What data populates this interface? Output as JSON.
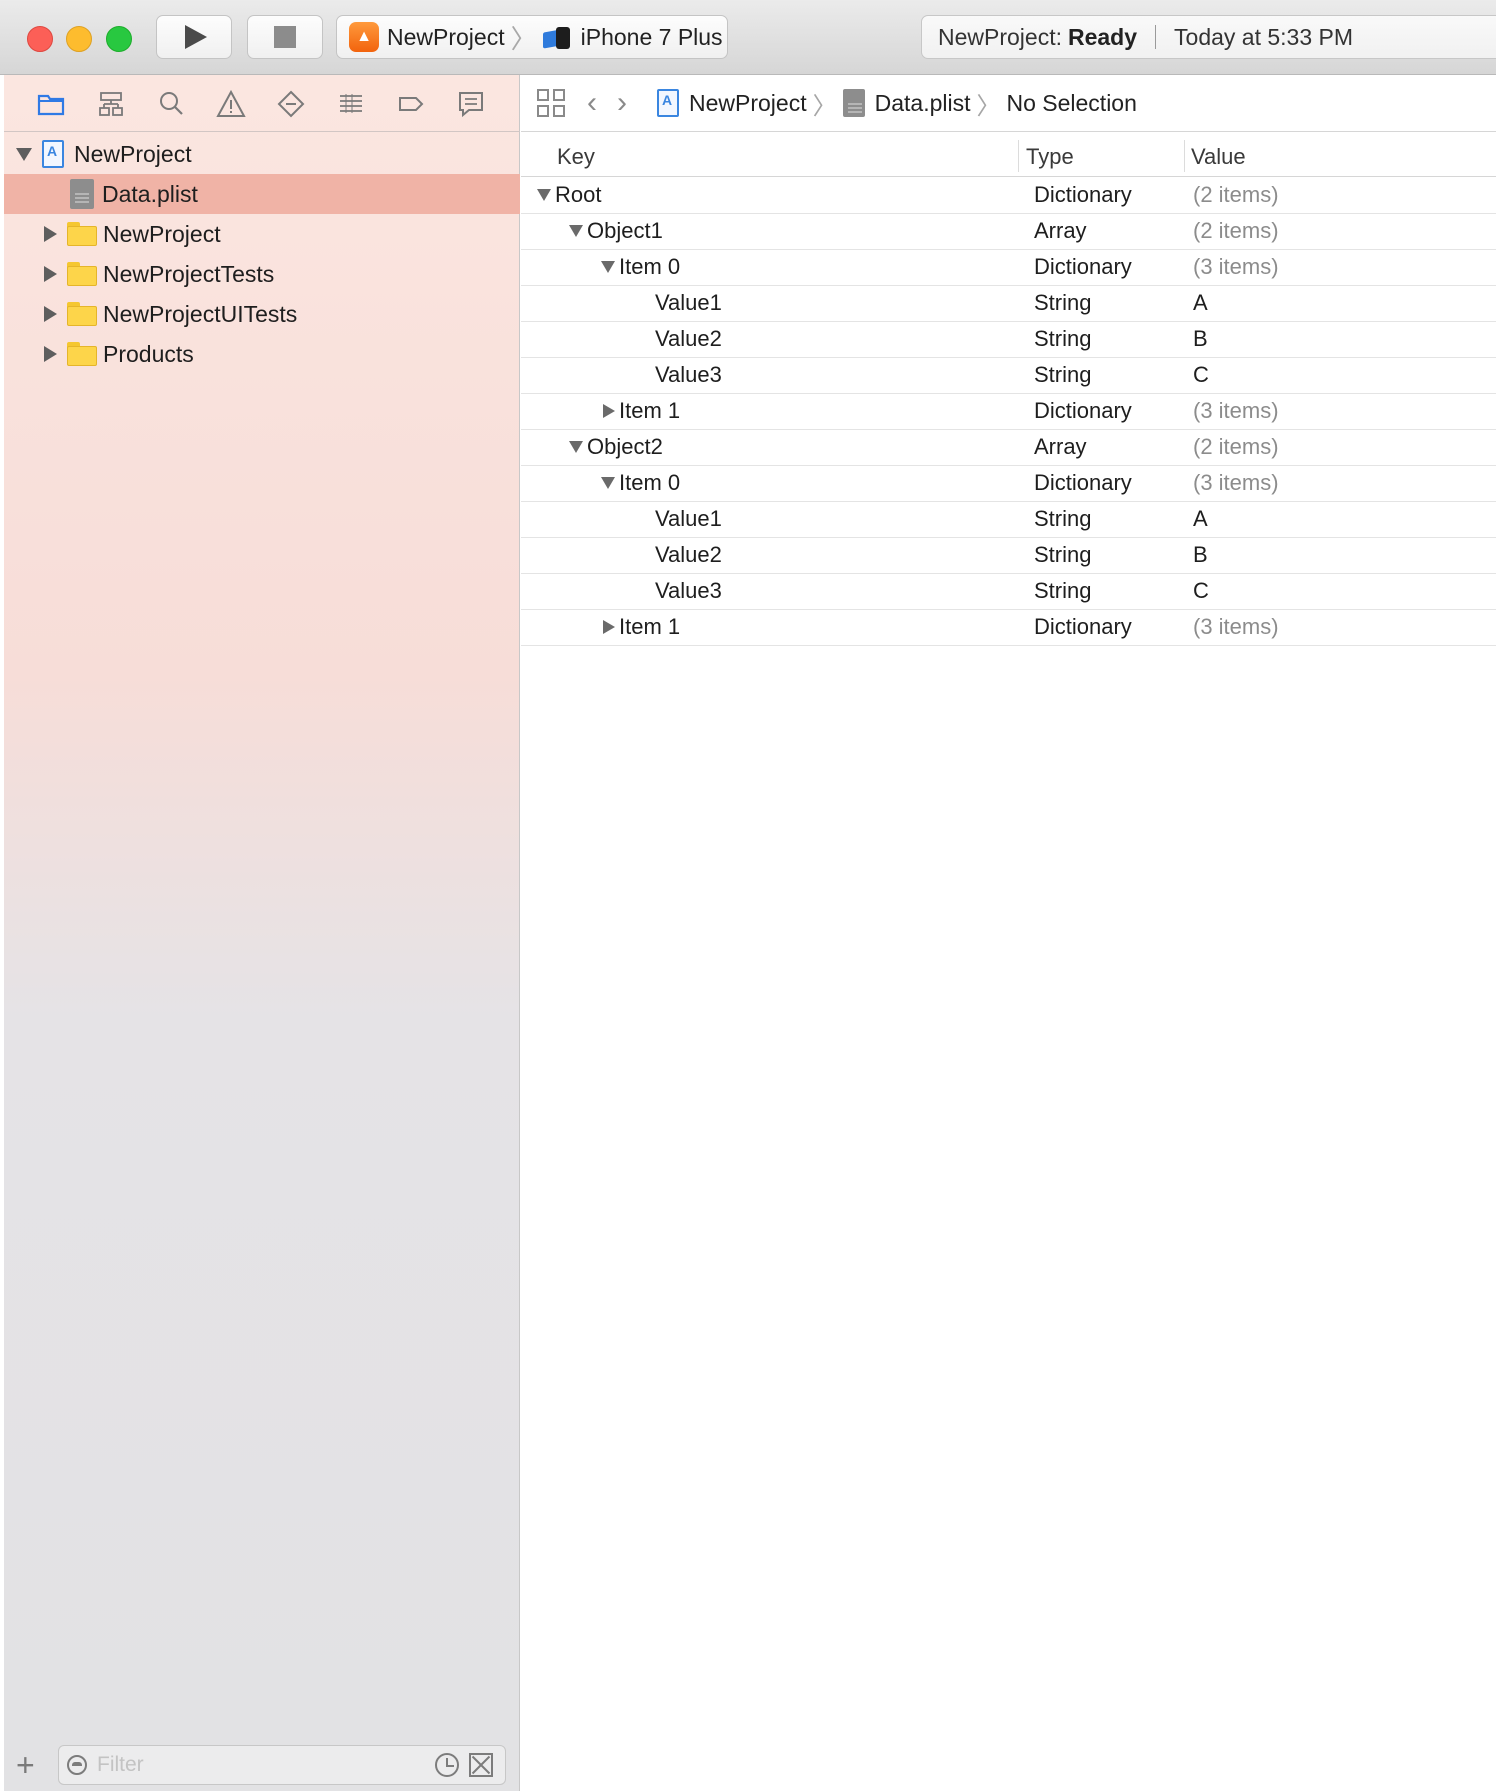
{
  "toolbar": {
    "scheme_name": "NewProject",
    "device_name": "iPhone 7 Plus",
    "status_project": "NewProject:",
    "status_state": "Ready",
    "status_time": "Today at 5:33 PM"
  },
  "navigator": {
    "tabs": [
      "folder-icon",
      "hierarchy-icon",
      "search-icon",
      "warning-icon",
      "test-diamond-icon",
      "debug-list-icon",
      "breakpoint-icon",
      "report-icon"
    ],
    "project": "NewProject",
    "items": [
      {
        "label": "Data.plist"
      },
      {
        "label": "NewProject"
      },
      {
        "label": "NewProjectTests"
      },
      {
        "label": "NewProjectUITests"
      },
      {
        "label": "Products"
      }
    ],
    "filter_placeholder": "Filter"
  },
  "jumpbar": {
    "project": "NewProject",
    "file": "Data.plist",
    "selection": "No Selection"
  },
  "plist": {
    "headers": {
      "key": "Key",
      "type": "Type",
      "value": "Value"
    },
    "rows": [
      {
        "key": "Root",
        "type": "Dictionary",
        "value": "(2 items)"
      },
      {
        "key": "Object1",
        "type": "Array",
        "value": "(2 items)"
      },
      {
        "key": "Item 0",
        "type": "Dictionary",
        "value": "(3 items)"
      },
      {
        "key": "Value1",
        "type": "String",
        "value": "A"
      },
      {
        "key": "Value2",
        "type": "String",
        "value": "B"
      },
      {
        "key": "Value3",
        "type": "String",
        "value": "C"
      },
      {
        "key": "Item 1",
        "type": "Dictionary",
        "value": "(3 items)"
      },
      {
        "key": "Object2",
        "type": "Array",
        "value": "(2 items)"
      },
      {
        "key": "Item 0",
        "type": "Dictionary",
        "value": "(3 items)"
      },
      {
        "key": "Value1",
        "type": "String",
        "value": "A"
      },
      {
        "key": "Value2",
        "type": "String",
        "value": "B"
      },
      {
        "key": "Value3",
        "type": "String",
        "value": "C"
      },
      {
        "key": "Item 1",
        "type": "Dictionary",
        "value": "(3 items)"
      }
    ]
  }
}
